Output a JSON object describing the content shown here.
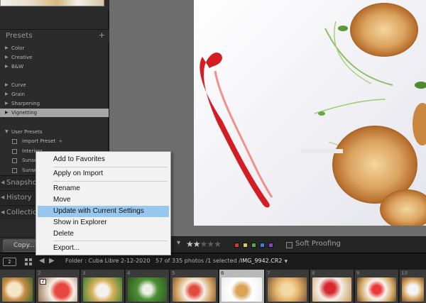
{
  "left_panel": {
    "presets": {
      "title": "Presets",
      "items": [
        {
          "label": "Color"
        },
        {
          "label": "Creative"
        },
        {
          "label": "B&W"
        },
        {
          "label": "Curve"
        },
        {
          "label": "Grain"
        },
        {
          "label": "Sharpening"
        },
        {
          "label": "Vignetting",
          "selected": true
        },
        {
          "label": "User Presets"
        }
      ],
      "user_presets": [
        {
          "label": "Import Preset",
          "plus": "+"
        },
        {
          "label": "Interiors"
        },
        {
          "label": "Sunset"
        },
        {
          "label": "Sunset"
        }
      ]
    },
    "sections": [
      {
        "label": "Snapshots"
      },
      {
        "label": "History"
      },
      {
        "label": "Collections"
      }
    ],
    "copy_button": "Copy..."
  },
  "context_menu": {
    "items": [
      {
        "label": "Add to Favorites"
      },
      {
        "label": "Apply on Import"
      },
      {
        "label": "Rename"
      },
      {
        "label": "Move"
      },
      {
        "label": "Update with Current Settings",
        "highlighted": true
      },
      {
        "label": "Show in Explorer"
      },
      {
        "label": "Delete"
      },
      {
        "label": "Export..."
      }
    ]
  },
  "toolbar": {
    "rating_stars": 2,
    "rating_max": 5,
    "color_labels": [
      "#d03a3a",
      "#d8d23a",
      "#4fae3d",
      "#3f7fd6",
      "#8a3fcf"
    ],
    "soft_proofing_label": "Soft Proofing"
  },
  "filmstrip_bar": {
    "monitor_label": "2",
    "folder_text": "Folder : Cuba Libre 2-12-2020",
    "count_text": "57 of 335 photos /1 selected /",
    "file_name": "IMG_9942.CR2"
  },
  "filmstrip": {
    "cells": [
      {
        "num": ""
      },
      {
        "num": "2",
        "badge": "2"
      },
      {
        "num": "3"
      },
      {
        "num": "4"
      },
      {
        "num": "5"
      },
      {
        "num": "6",
        "selected": true
      },
      {
        "num": "7"
      },
      {
        "num": "8"
      },
      {
        "num": "9"
      },
      {
        "num": "10"
      }
    ]
  }
}
